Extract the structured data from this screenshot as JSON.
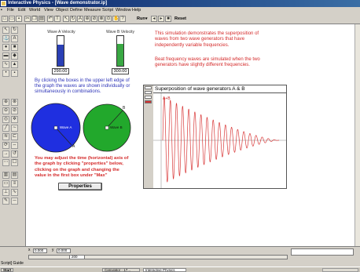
{
  "window": {
    "title": "Interactive Physics - [Wave demonstrator.ip]"
  },
  "menu": [
    "File",
    "Edit",
    "World",
    "View",
    "Object",
    "Define",
    "Measure",
    "Script",
    "Window",
    "Help"
  ],
  "toolbar": {
    "run_label": "Run",
    "reset_label": "Reset"
  },
  "content": {
    "meter_a": {
      "label": "Wave A Velocity",
      "value": "290.00",
      "fill": 0.72,
      "color": "#2a3fb5"
    },
    "meter_b": {
      "label": "Wave B Velocity",
      "value": "300.00",
      "fill": 0.75,
      "color": "#39a843"
    },
    "intro_text": [
      "This simulation demonstrates the superposition of",
      "waves from two wave generators that have",
      "independently variable frequencies."
    ],
    "beat_text": [
      "Beat frequency waves are simulated when the two",
      "generators have slightly different  frequencies."
    ],
    "click_text": [
      "By clicking the boxes in the upper left edge of",
      "the graph the waves are shown individually or",
      "simultaneously in combinations."
    ],
    "wheel_a": {
      "label": "A",
      "center_label": "Wave A",
      "color": "#1f2fe0"
    },
    "wheel_b": {
      "label": "B",
      "center_label": "Wave B",
      "color": "#22a82c"
    },
    "adjust_text": [
      "You may adjust the time (horizontal) axis of",
      "the graph by clicking \"properties\" below,",
      "clicking on the graph and changing the",
      "value in the first box under \"Max\""
    ],
    "properties_button": "Properties",
    "graph": {
      "title": "Superposition of wave generators A & B",
      "series_label": "A+B"
    }
  },
  "status": {
    "x_label": "x",
    "x_value": "0.000",
    "y_label": "y",
    "y_value": "0.000",
    "zoom": "200",
    "app_label": "Script] Guide"
  },
  "taskbar": {
    "items": [
      "Start",
      "Calculator - 17...",
      "Interactive Physics"
    ]
  },
  "chart_data": {
    "type": "line",
    "title": "Superposition of wave generators A & B",
    "series": [
      {
        "name": "A+B",
        "shape": "decaying oscillation",
        "cycles": 19
      }
    ],
    "xlabel": "",
    "ylabel": ""
  }
}
